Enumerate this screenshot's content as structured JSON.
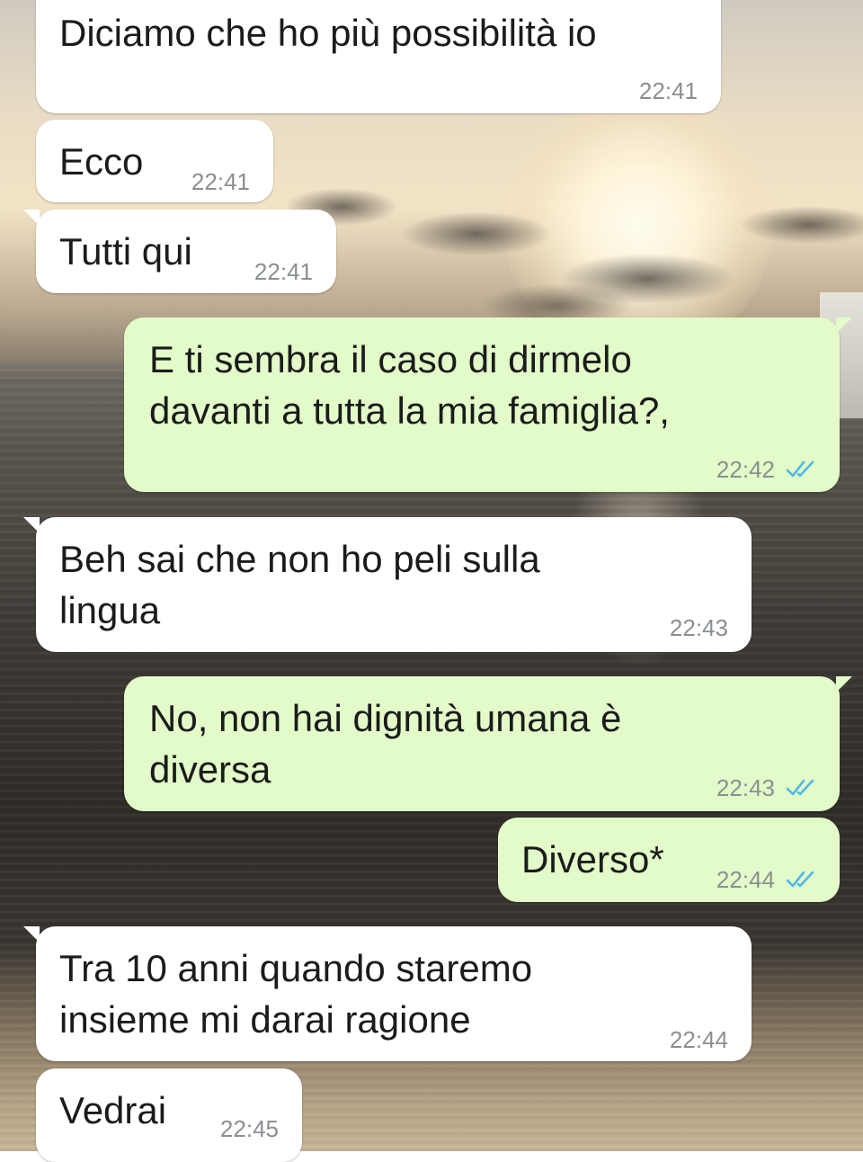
{
  "messages": [
    {
      "direction": "incoming",
      "text": "Diciamo che ho più possibilità io",
      "time": "22:41"
    },
    {
      "direction": "incoming",
      "text": "Ecco",
      "time": "22:41"
    },
    {
      "direction": "incoming",
      "text": "Tutti qui",
      "time": "22:41"
    },
    {
      "direction": "outgoing",
      "text": "E ti sembra il caso di dirmelo\ndavanti a tutta la mia famiglia?,",
      "time": "22:42",
      "status": "read-double-check-icon"
    },
    {
      "direction": "incoming",
      "text": "Beh sai che non ho peli sulla\nlingua",
      "time": "22:43"
    },
    {
      "direction": "outgoing",
      "text": "No, non hai dignità umana è\ndiversa",
      "time": "22:43",
      "status": "read-double-check-icon"
    },
    {
      "direction": "outgoing",
      "text": "Diverso*",
      "time": "22:44",
      "status": "read-double-check-icon"
    },
    {
      "direction": "incoming",
      "text": "Tra 10 anni quando staremo\ninsieme mi darai ragione",
      "time": "22:44"
    },
    {
      "direction": "incoming",
      "text": "Vedrai",
      "time": "22:45"
    }
  ],
  "colors": {
    "incoming_bubble": "#ffffff",
    "outgoing_bubble": "#e2fbc8",
    "timestamp": "#8b8f93",
    "read_ticks": "#4fb6ec"
  }
}
